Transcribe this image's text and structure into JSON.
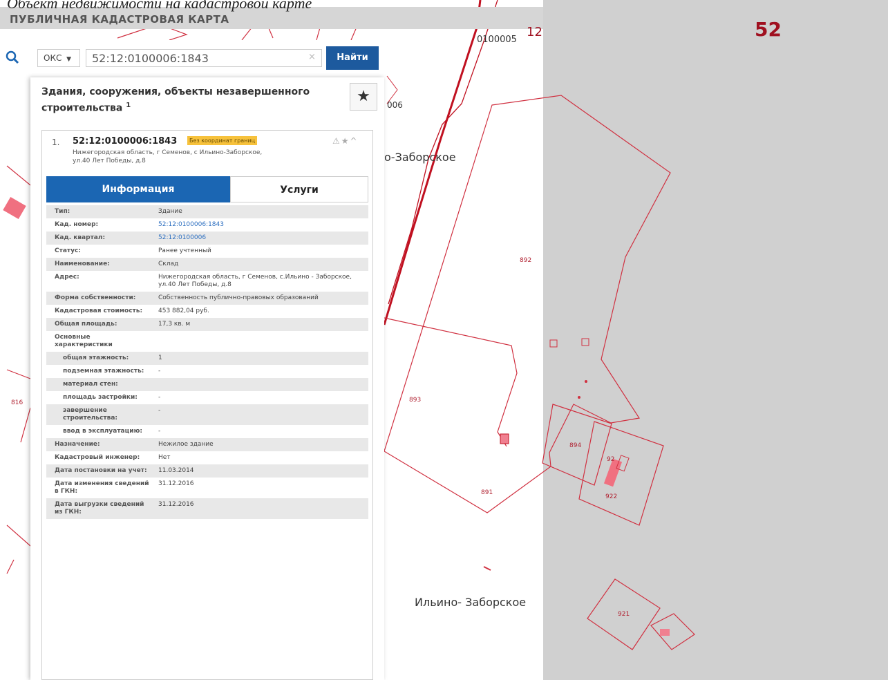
{
  "caption": "Объект недвижимости на кадастровой карте",
  "map": {
    "title": "ПУБЛИЧНАЯ КАДАСТРОВАЯ КАРТА",
    "labels": {
      "block_code": "0100005",
      "block_num": "12",
      "region": "52",
      "side_006": "006",
      "village_top": "о-Заборское",
      "village_bottom": "Ильино- Заборское",
      "p892": "892",
      "p893": "893",
      "p891": "891",
      "p894": "894",
      "p921": "921",
      "p816": "816",
      "p92a": "92",
      "p922": "922"
    }
  },
  "search": {
    "type_label": "ОКС",
    "value": "52:12:0100006:1843",
    "clear": "×",
    "button_label": "Найти"
  },
  "panel": {
    "title": "Здания, сооружения, объекты незавершенного строительства",
    "title_sup": "1",
    "result": {
      "number": "1.",
      "cad_number": "52:12:0100006:1843",
      "badge": "Без координат границ",
      "address": "Нижегородская область, г Семенов, с Ильино-Заборское, ул.40 Лет Победы, д.8"
    },
    "tabs": {
      "info": "Информация",
      "services": "Услуги"
    },
    "rows": [
      {
        "k": "Тип:",
        "v": "Здание",
        "link": false,
        "sub": false
      },
      {
        "k": "Кад. номер:",
        "v": "52:12:0100006:1843",
        "link": true,
        "sub": false
      },
      {
        "k": "Кад. квартал:",
        "v": "52:12:0100006",
        "link": true,
        "sub": false
      },
      {
        "k": "Статус:",
        "v": "Ранее учтенный",
        "link": false,
        "sub": false
      },
      {
        "k": "Наименование:",
        "v": "Склад",
        "link": false,
        "sub": false
      },
      {
        "k": "Адрес:",
        "v": "Нижегородская область, г Семенов, с.Ильино - Заборское, ул.40 Лет Победы, д.8",
        "link": false,
        "sub": false
      },
      {
        "k": "Форма собственности:",
        "v": "Собственность публично-правовых образований",
        "link": false,
        "sub": false
      },
      {
        "k": "Кадастровая стоимость:",
        "v": "453 882,04 руб.",
        "link": false,
        "sub": false
      },
      {
        "k": "Общая площадь:",
        "v": "17,3 кв. м",
        "link": false,
        "sub": false
      },
      {
        "k": "Основные характеристики",
        "v": "",
        "link": false,
        "sub": false
      },
      {
        "k": "общая этажность:",
        "v": "1",
        "link": false,
        "sub": true
      },
      {
        "k": "подземная этажность:",
        "v": "-",
        "link": false,
        "sub": true
      },
      {
        "k": "материал стен:",
        "v": "",
        "link": false,
        "sub": true
      },
      {
        "k": "площадь застройки:",
        "v": "-",
        "link": false,
        "sub": true
      },
      {
        "k": "завершение строительства:",
        "v": "-",
        "link": false,
        "sub": true
      },
      {
        "k": "ввод в эксплуатацию:",
        "v": "-",
        "link": false,
        "sub": true
      },
      {
        "k": "Назначение:",
        "v": "Нежилое здание",
        "link": false,
        "sub": false
      },
      {
        "k": "Кадастровый инженер:",
        "v": "Нет",
        "link": false,
        "sub": false
      },
      {
        "k": "Дата постановки на учет:",
        "v": "11.03.2014",
        "link": false,
        "sub": false
      },
      {
        "k": "Дата изменения сведений в ГКН:",
        "v": "31.12.2016",
        "link": false,
        "sub": false
      },
      {
        "k": "Дата выгрузки сведений из ГКН:",
        "v": "31.12.2016",
        "link": false,
        "sub": false
      }
    ]
  },
  "colors": {
    "parcel_line": "#d03040",
    "block_line": "#c01020",
    "panel_blue": "#1b66b3",
    "button_blue": "#1d5a9e"
  }
}
